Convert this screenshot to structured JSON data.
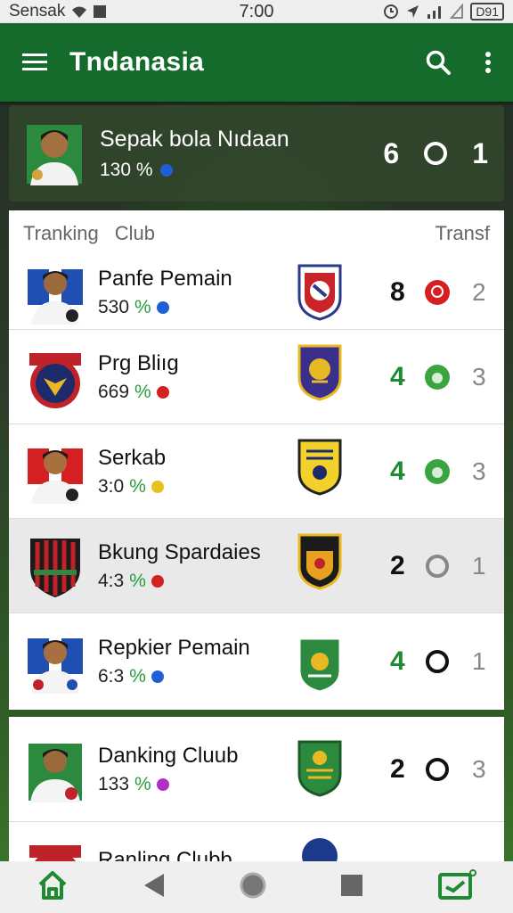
{
  "status_bar": {
    "carrier": "Sensak",
    "time": "7:00",
    "battery": "D91"
  },
  "app_bar": {
    "title": "Tndanasia",
    "icons": [
      "menu-icon",
      "search-icon",
      "more-vert-icon"
    ]
  },
  "hero": {
    "name": "Sepak bola Nıdaan",
    "meta": "130 %",
    "score_left": "6",
    "score_right": "1"
  },
  "table": {
    "headers": [
      "Tranking",
      "Club",
      "Transf"
    ],
    "rows": [
      {
        "name": "Panfe Pemain",
        "meta": "530",
        "pct": "%",
        "dot_color": "#1f5fd6",
        "num": "8",
        "num_color": "#111",
        "status": "red",
        "rank": "2"
      },
      {
        "name": "Prg Bliıg",
        "meta": "669",
        "pct": "%",
        "dot_color": "#d42020",
        "num": "4",
        "num_color": "#1f8a32",
        "status": "green",
        "rank": "3"
      },
      {
        "name": "Serkab",
        "meta": "3:0",
        "pct": "%",
        "dot_color": "#e8c020",
        "num": "4",
        "num_color": "#1f8a32",
        "status": "green",
        "rank": "3"
      },
      {
        "name": "Bkung Spardaies",
        "meta": "4:3",
        "pct": "%",
        "dot_color": "#d42020",
        "num": "2",
        "num_color": "#111",
        "status": "grey-ring",
        "rank": "1"
      },
      {
        "name": "Repkier Pemain",
        "meta": "6:3",
        "pct": "%",
        "dot_color": "#1f5fd6",
        "num": "4",
        "num_color": "#1f8a32",
        "status": "black-ring",
        "rank": "1"
      },
      {
        "name": "Danking Cluub",
        "meta": "133",
        "pct": "%",
        "dot_color": "#b030c8",
        "num": "2",
        "num_color": "#111",
        "status": "black-ring",
        "rank": "3"
      },
      {
        "name": "Ranling Clubb",
        "meta": "",
        "pct": "",
        "dot_color": "",
        "num": "",
        "num_color": "#111",
        "status": "",
        "rank": ""
      }
    ]
  },
  "nav_bar": {
    "icons": [
      "home-icon",
      "back-icon",
      "home-circle-icon",
      "recents-icon",
      "ticket-icon"
    ]
  },
  "colors": {
    "app_bar": "#156b2c",
    "accent_green": "#1f8a32"
  }
}
